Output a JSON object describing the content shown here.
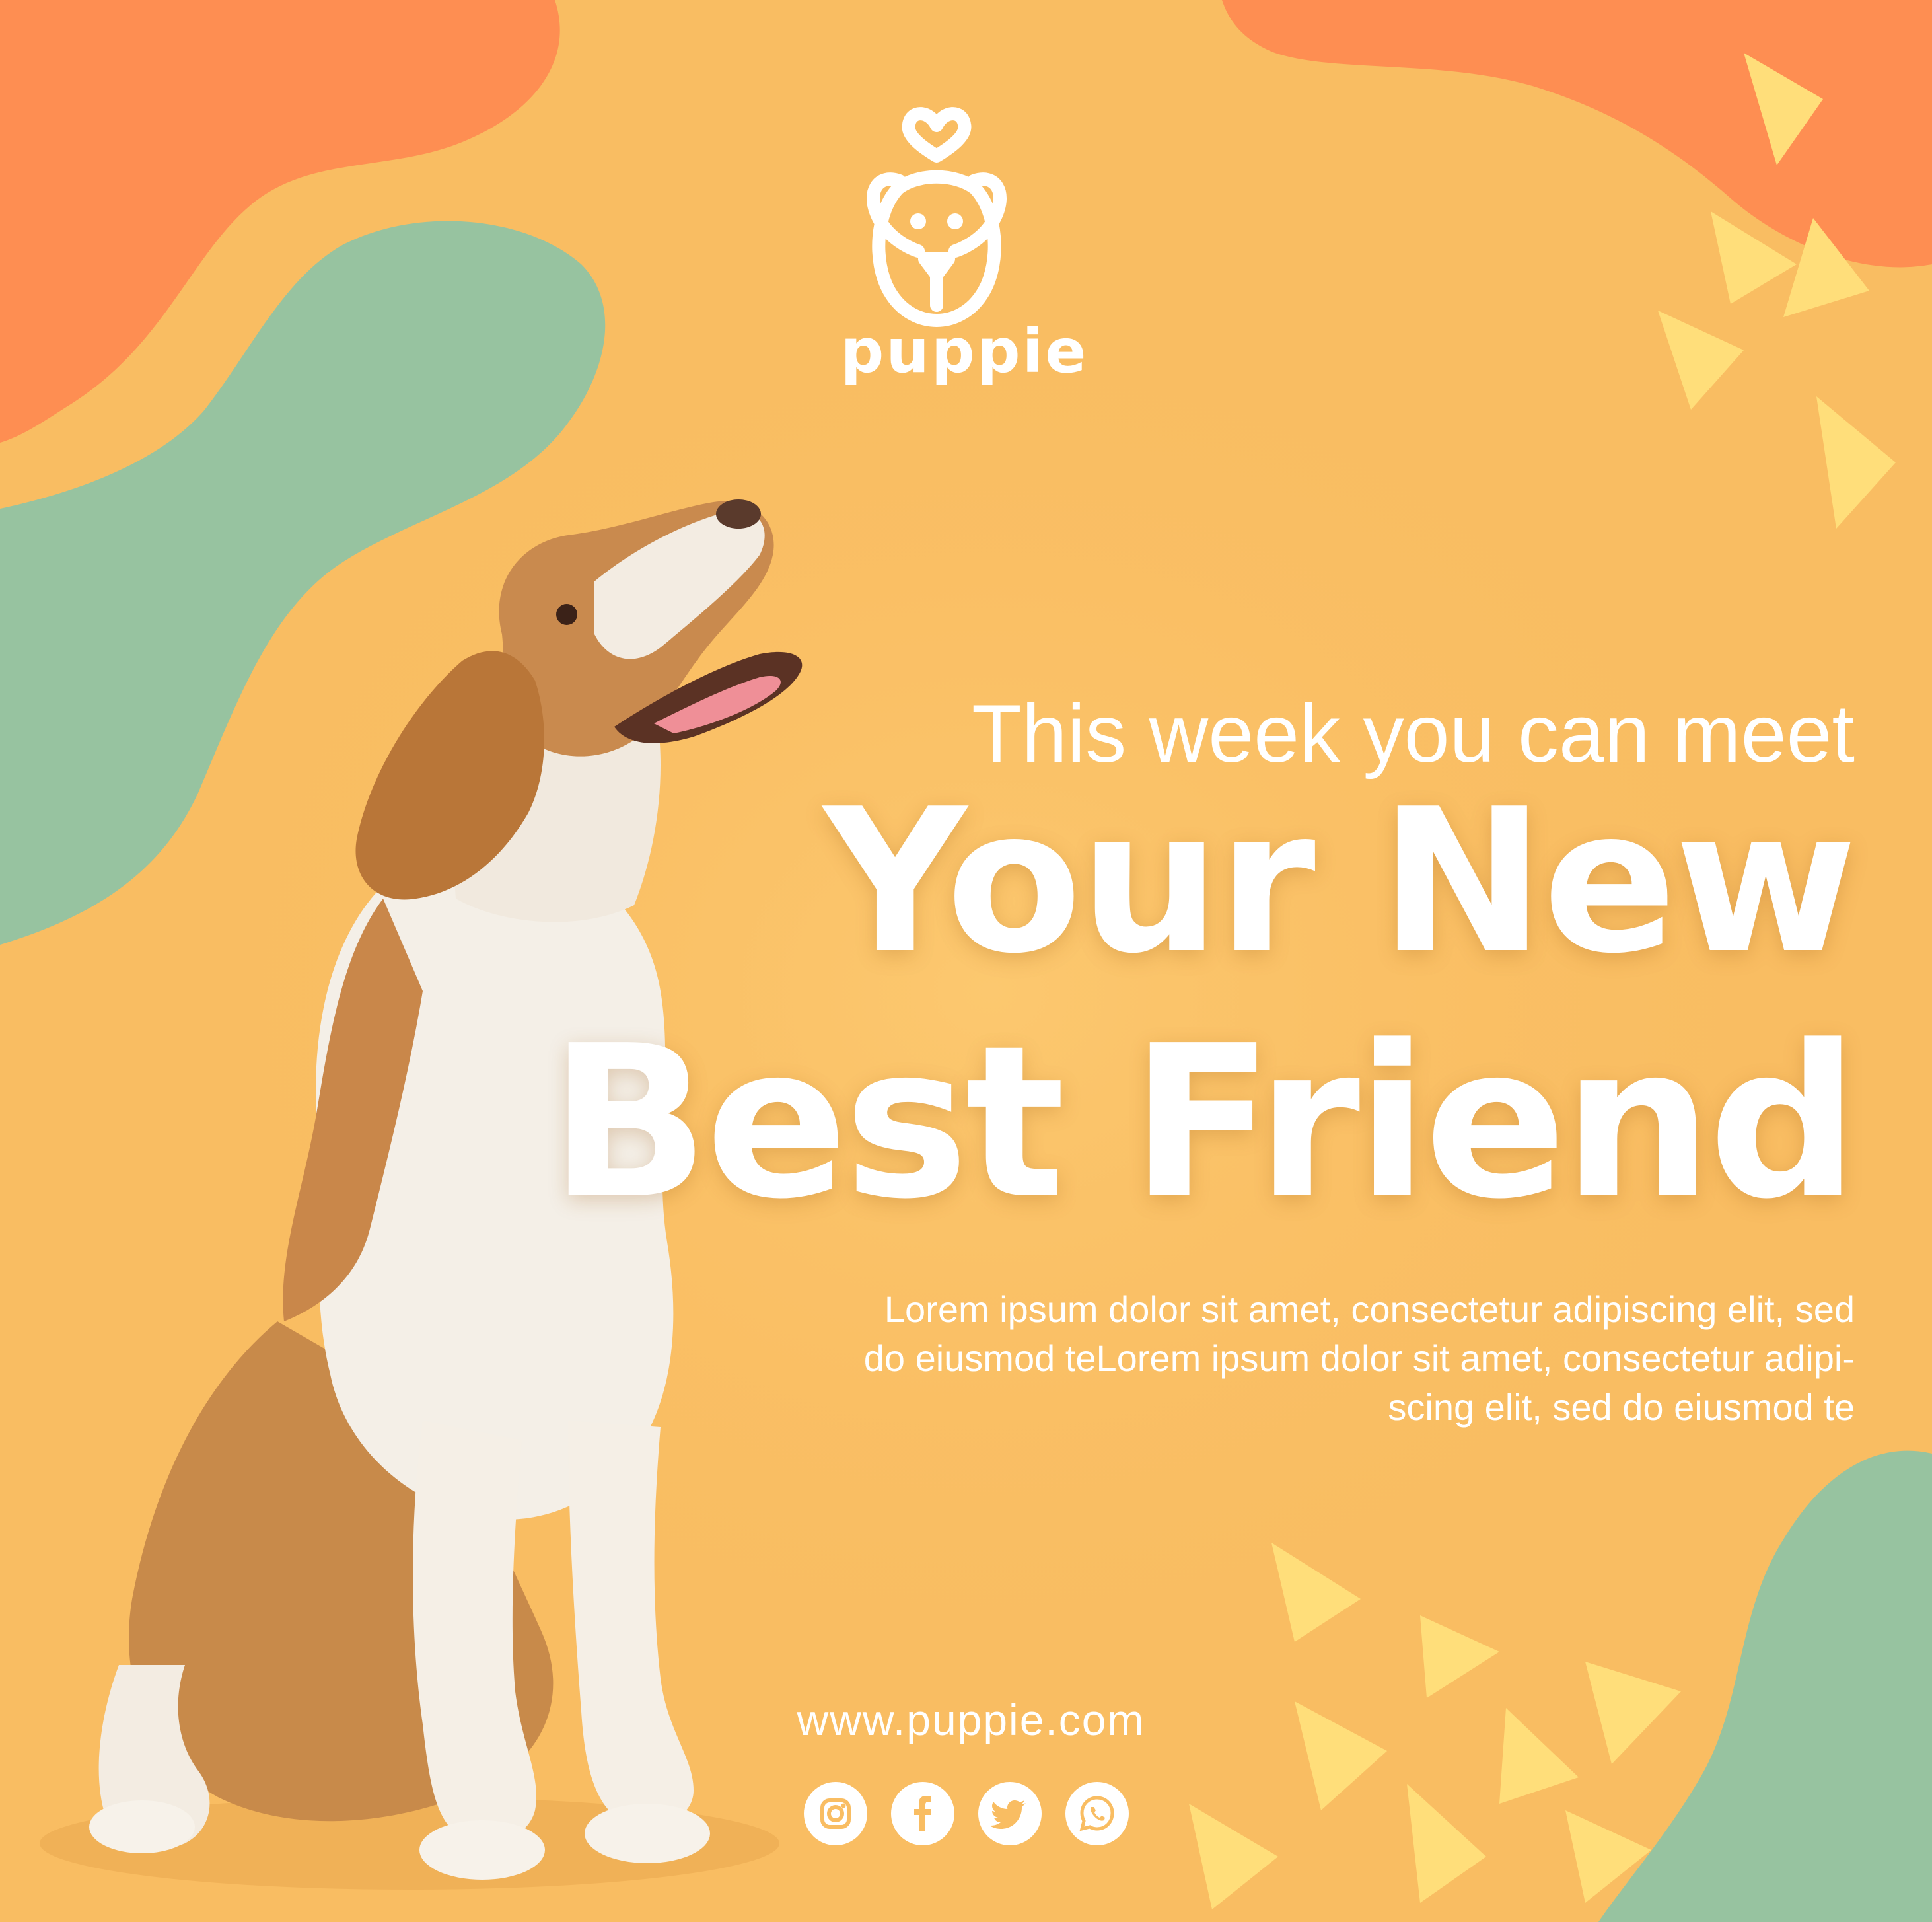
{
  "brand": {
    "name": "puppie",
    "logo_icon": "dog-face-heart-icon"
  },
  "hero": {
    "tagline": "This week you can meet",
    "headline_line1": "Your New",
    "headline_line2": "Best Friend",
    "body_lines": [
      "Lorem ipsum dolor sit amet, consectetur adipiscing elit, sed",
      "do eiusmod teLorem ipsum dolor sit amet, consectetur adipi-",
      "scing elit, sed do eiusmod te"
    ]
  },
  "footer": {
    "website": "www.puppie.com",
    "social_icons": [
      "instagram-icon",
      "facebook-icon",
      "twitter-icon",
      "whatsapp-icon"
    ]
  },
  "colors": {
    "background": "#f9bd62",
    "orange_blob": "#fe8e52",
    "green_blob": "#97c3a0",
    "triangle": "#ffde7a",
    "text": "#ffffff"
  }
}
